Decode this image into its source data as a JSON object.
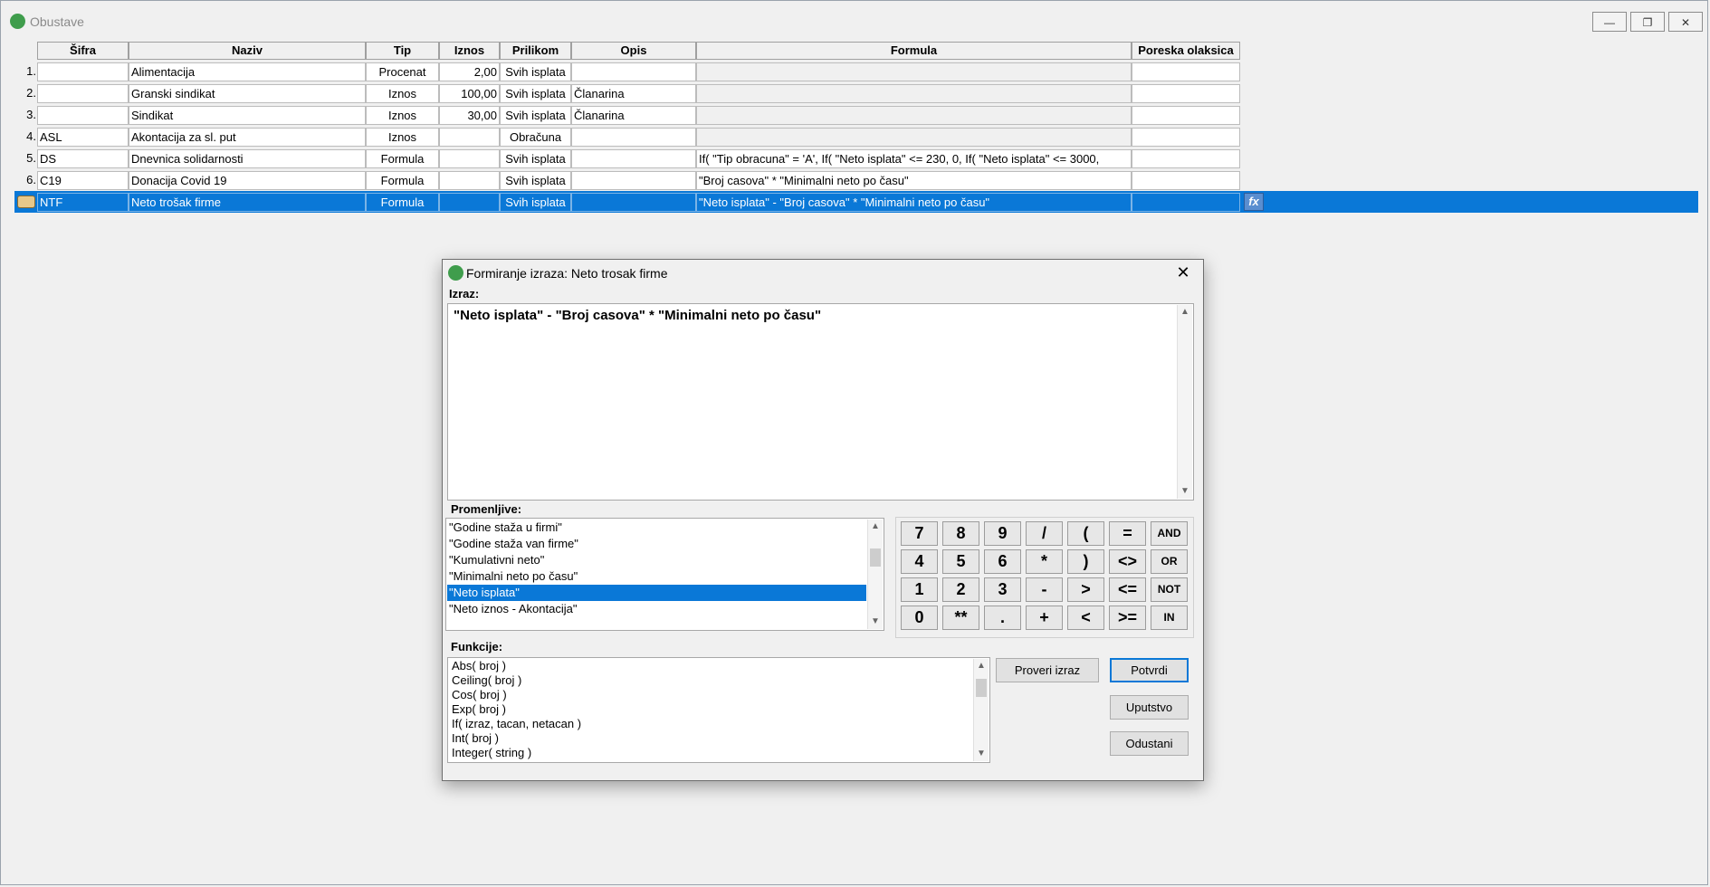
{
  "window": {
    "title": "Obustave",
    "min_glyph": "—",
    "max_glyph": "❐",
    "close_glyph": "✕"
  },
  "grid": {
    "headers": [
      "Šifra",
      "Naziv",
      "Tip",
      "Iznos",
      "Prilikom",
      "Opis",
      "Formula",
      "Poreska olaksica"
    ],
    "rows": [
      {
        "num": "1.",
        "sifra": "",
        "naziv": "Alimentacija",
        "tip": "Procenat",
        "iznos": "2,00",
        "prilikom": "Svih isplata",
        "opis": "",
        "formula": ""
      },
      {
        "num": "2.",
        "sifra": "",
        "naziv": "Granski sindikat",
        "tip": "Iznos",
        "iznos": "100,00",
        "prilikom": "Svih isplata",
        "opis": "Članarina",
        "formula": ""
      },
      {
        "num": "3.",
        "sifra": "",
        "naziv": "Sindikat",
        "tip": "Iznos",
        "iznos": "30,00",
        "prilikom": "Svih isplata",
        "opis": "Članarina",
        "formula": ""
      },
      {
        "num": "4.",
        "sifra": "ASL",
        "naziv": "Akontacija za sl. put",
        "tip": "Iznos",
        "iznos": "",
        "prilikom": "Obračuna",
        "opis": "",
        "formula": ""
      },
      {
        "num": "5.",
        "sifra": "DS",
        "naziv": "Dnevnica solidarnosti",
        "tip": "Formula",
        "iznos": "",
        "prilikom": "Svih isplata",
        "opis": "",
        "formula": "If(  \"Tip obracuna\" = 'A', If(  \"Neto isplata\" <= 230, 0, If(  \"Neto isplata\" <= 3000,"
      },
      {
        "num": "6.",
        "sifra": "C19",
        "naziv": "Donacija Covid 19",
        "tip": "Formula",
        "iznos": "",
        "prilikom": "Svih isplata",
        "opis": "",
        "formula": "\"Broj casova\"  *  \"Minimalni neto po času\""
      },
      {
        "num": "",
        "sifra": "NTF",
        "naziv": "Neto trošak firme",
        "tip": "Formula",
        "iznos": "",
        "prilikom": "Svih isplata",
        "opis": "",
        "formula": "\"Neto isplata\"  -  \"Broj casova\"  *  \"Minimalni neto po času\""
      }
    ],
    "fx_label": "fx"
  },
  "dialog": {
    "title": "Formiranje izraza: Neto trosak firme",
    "close_glyph": "✕",
    "izraz_label": "Izraz:",
    "expression": "\"Neto isplata\"  -  \"Broj casova\"  *  \"Minimalni neto po času\"",
    "promenljive_label": "Promenljive:",
    "variables": [
      "\"Godine staža u firmi\"",
      "\"Godine staža van firme\"",
      "\"Kumulativni neto\"",
      "\"Minimalni neto po času\"",
      "\"Neto isplata\"",
      "\"Neto iznos - Akontacija\""
    ],
    "selected_variable": "\"Neto isplata\"",
    "funkcije_label": "Funkcije:",
    "functions": [
      "Abs( broj )",
      "Ceiling( broj )",
      "Cos( broj )",
      "Exp( broj )",
      "If( izraz, tacan, netacan )",
      "Int( broj )",
      "Integer( string )"
    ],
    "keys": [
      [
        "7",
        "8",
        "9",
        "/",
        "(",
        "=",
        "AND"
      ],
      [
        "4",
        "5",
        "6",
        "*",
        ")",
        "<>",
        "OR"
      ],
      [
        "1",
        "2",
        "3",
        "-",
        ">",
        "<=",
        "NOT"
      ],
      [
        "0",
        "**",
        ".",
        "+",
        "<",
        ">=",
        "IN"
      ]
    ],
    "buttons": {
      "proveri": "Proveri izraz",
      "potvrdi": "Potvrdi",
      "uputstvo": "Uputstvo",
      "odustani": "Odustani"
    },
    "scroll_up": "▲",
    "scroll_down": "▼"
  }
}
